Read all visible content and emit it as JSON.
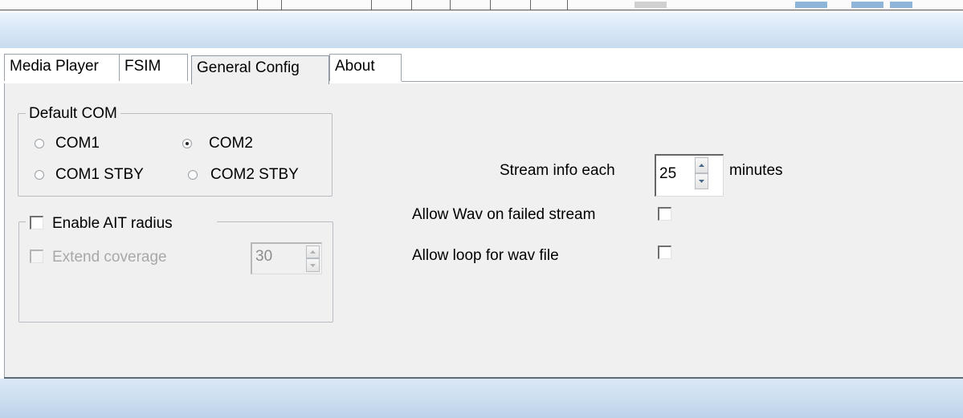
{
  "tabs": [
    {
      "label": "Media Player"
    },
    {
      "label": "FSIM"
    },
    {
      "label": "General Config",
      "active": true
    },
    {
      "label": "About"
    }
  ],
  "default_com": {
    "legend": "Default COM",
    "options": [
      {
        "label": "COM1",
        "checked": false
      },
      {
        "label": "COM2",
        "checked": true
      },
      {
        "label": "COM1 STBY",
        "checked": false
      },
      {
        "label": "COM2 STBY",
        "checked": false
      }
    ]
  },
  "ait": {
    "enable_label": "Enable AIT radius",
    "enable_checked": false,
    "extend_label": "Extend coverage",
    "extend_checked": false,
    "extend_value": "30",
    "extend_enabled": false
  },
  "stream": {
    "info_label": "Stream info each",
    "info_value": "25",
    "unit_label": "minutes",
    "allow_wav_label": "Allow Wav on failed stream",
    "allow_wav_checked": false,
    "allow_loop_label": "Allow loop for wav file",
    "allow_loop_checked": false
  },
  "colors": {
    "header_bar": "#d6e6f6",
    "panel_bg": "#f0f0f0",
    "disabled_text": "#a8a8a8"
  }
}
